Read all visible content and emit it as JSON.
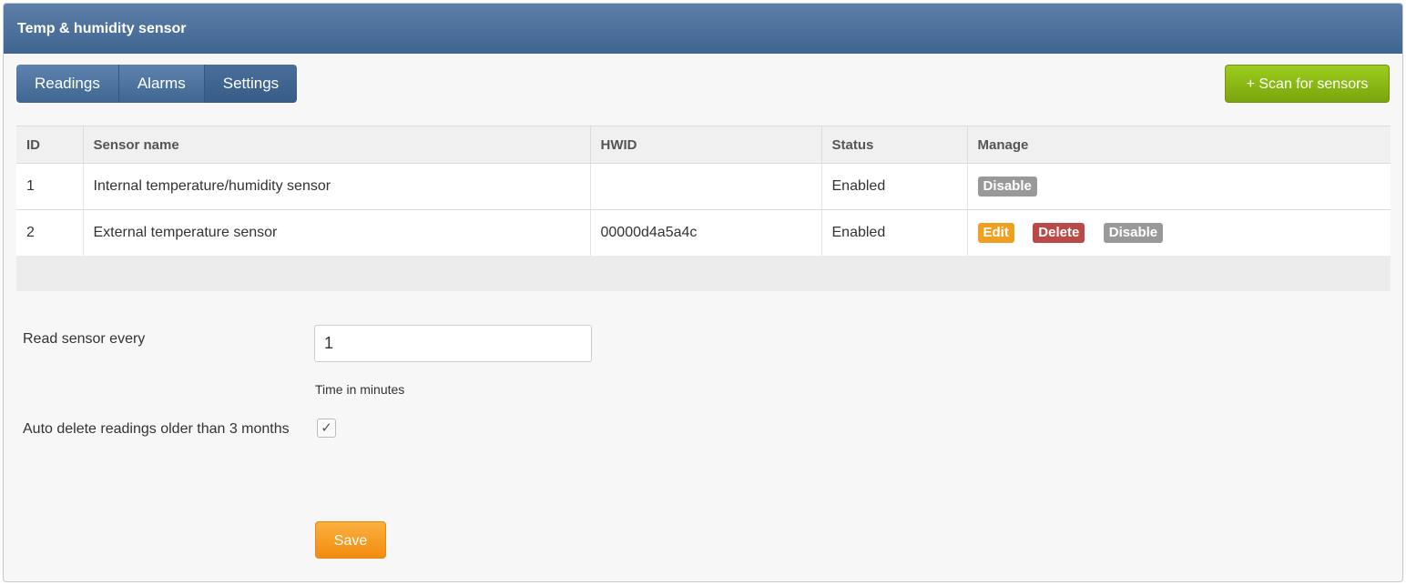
{
  "header": {
    "title": "Temp & humidity sensor"
  },
  "tabs": [
    {
      "label": "Readings"
    },
    {
      "label": "Alarms"
    },
    {
      "label": "Settings"
    }
  ],
  "toolbar": {
    "scan_label": "+ Scan for sensors"
  },
  "table": {
    "columns": [
      "ID",
      "Sensor name",
      "HWID",
      "Status",
      "Manage"
    ],
    "rows": [
      {
        "id": "1",
        "name": "Internal temperature/humidity sensor",
        "hwid": "",
        "status": "Enabled",
        "actions": [
          "Disable"
        ]
      },
      {
        "id": "2",
        "name": "External temperature sensor",
        "hwid": "00000d4a5a4c",
        "status": "Enabled",
        "actions": [
          "Edit",
          "Delete",
          "Disable"
        ]
      }
    ]
  },
  "settings": {
    "read_label": "Read sensor every",
    "read_value": "1",
    "read_help": "Time in minutes",
    "autodelete_label": "Auto delete readings older than 3 months",
    "autodelete_checked": true,
    "checkmark": "✓",
    "save_label": "Save"
  },
  "colors": {
    "header": "#4a6f9c",
    "scan_button": "#8cbb14",
    "status_enabled": "#1e8a1e",
    "edit": "#f0a020",
    "delete": "#b94a48",
    "disable": "#999999",
    "save": "#f5a020"
  }
}
